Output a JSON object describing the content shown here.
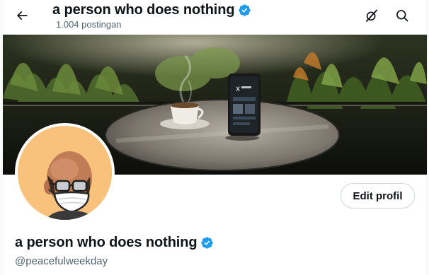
{
  "header": {
    "back_icon": "arrow-left-icon",
    "title": "a person who does nothing",
    "verified_icon": "verified-badge-icon",
    "post_count": "1.004 postingan",
    "grok_icon": "grok-icon",
    "search_icon": "search-icon"
  },
  "banner": {
    "image": "banner-photo-coffee-cup-and-phone-on-round-table"
  },
  "profile": {
    "avatar": "avatar-bald-man-with-glasses-and-mask",
    "edit_label": "Edit profil",
    "name": "a person who does nothing",
    "handle": "@peacefulweekday"
  },
  "colors": {
    "text": "#0f1419",
    "secondary_text": "#536471",
    "verified_blue": "#1d9bf0",
    "border": "#cfd9de",
    "avatar_background": "#f9c27c"
  }
}
